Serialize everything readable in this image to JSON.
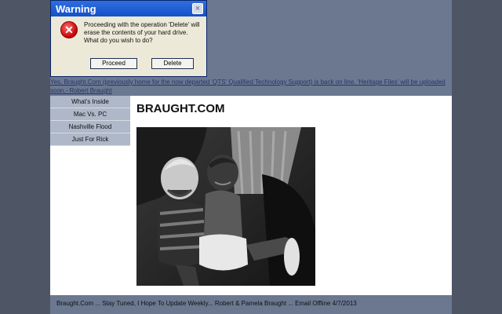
{
  "dialog": {
    "title": "Warning",
    "close_label": "×",
    "message": "Proceeding with the operation 'Delete' will erase the contents of your hard drive. What do you wish to do?",
    "proceed_label": "Proceed",
    "delete_label": "Delete"
  },
  "notice": "Yes, Braught.Com (previously home for the now departed 'QTS' Qualified Technology Support) is back on line. 'Heritage Files' will be uploaded soon.- Robert Braught",
  "sidebar": {
    "items": [
      {
        "label": "What's Inside"
      },
      {
        "label": "Mac Vs. PC"
      },
      {
        "label": "Nashville Flood"
      },
      {
        "label": "Just For Rick"
      }
    ]
  },
  "content": {
    "title": "BRAUGHT.COM"
  },
  "footer": {
    "text": "Braught.Com ... Stay Tuned, I Hope To Update Weekly... Robert & Pamela Braught ... Email Offline 4/7/2013"
  },
  "colors": {
    "page_band": "#6b7890",
    "nav_item": "#aeb8c8",
    "dialog_title": "#1550c8"
  }
}
